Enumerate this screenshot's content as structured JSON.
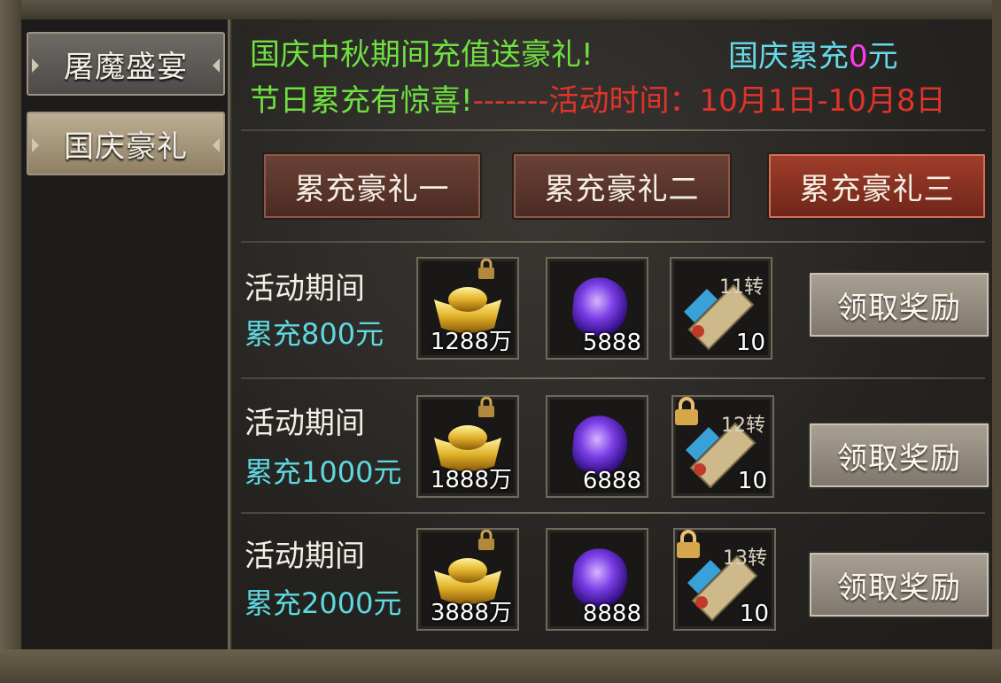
{
  "sidebar": {
    "tabs": [
      {
        "label": "屠魔盛宴"
      },
      {
        "label": "国庆豪礼"
      }
    ]
  },
  "header": {
    "line1": "国庆中秋期间充值送豪礼!",
    "total_label": "国庆累充",
    "total_value": "0",
    "total_unit": "元",
    "line2_green": "节日累充有惊喜!",
    "line2_red": "-------活动时间：10月1日-10月8日"
  },
  "gift_tabs": [
    {
      "label": "累充豪礼一"
    },
    {
      "label": "累充豪礼二"
    },
    {
      "label": "累充豪礼三"
    }
  ],
  "rows": [
    {
      "title": "活动期间",
      "amount": "累充800元",
      "items": [
        {
          "icon": "gold-ingot-icon",
          "qty": "1288万",
          "locked": true
        },
        {
          "icon": "purple-gem-icon",
          "qty": "5888",
          "locked": false
        },
        {
          "icon": "scroll-11-icon",
          "badge": "11转",
          "qty": "10",
          "locked": false
        }
      ],
      "button": "领取奖励"
    },
    {
      "title": "活动期间",
      "amount": "累充1000元",
      "items": [
        {
          "icon": "gold-ingot-icon",
          "qty": "1888万",
          "locked": true
        },
        {
          "icon": "purple-gem-icon",
          "qty": "6888",
          "locked": false
        },
        {
          "icon": "scroll-12-icon",
          "badge": "12转",
          "qty": "10",
          "locked": true
        }
      ],
      "button": "领取奖励"
    },
    {
      "title": "活动期间",
      "amount": "累充2000元",
      "items": [
        {
          "icon": "gold-ingot-icon",
          "qty": "3888万",
          "locked": true
        },
        {
          "icon": "purple-gem-icon",
          "qty": "8888",
          "locked": false
        },
        {
          "icon": "scroll-13-icon",
          "badge": "13转",
          "qty": "10",
          "locked": true
        }
      ],
      "button": "领取奖励"
    }
  ],
  "colors": {
    "green": "#6fe040",
    "red": "#e0342a",
    "cyan": "#64d9e8",
    "magenta": "#ff3bf0"
  }
}
